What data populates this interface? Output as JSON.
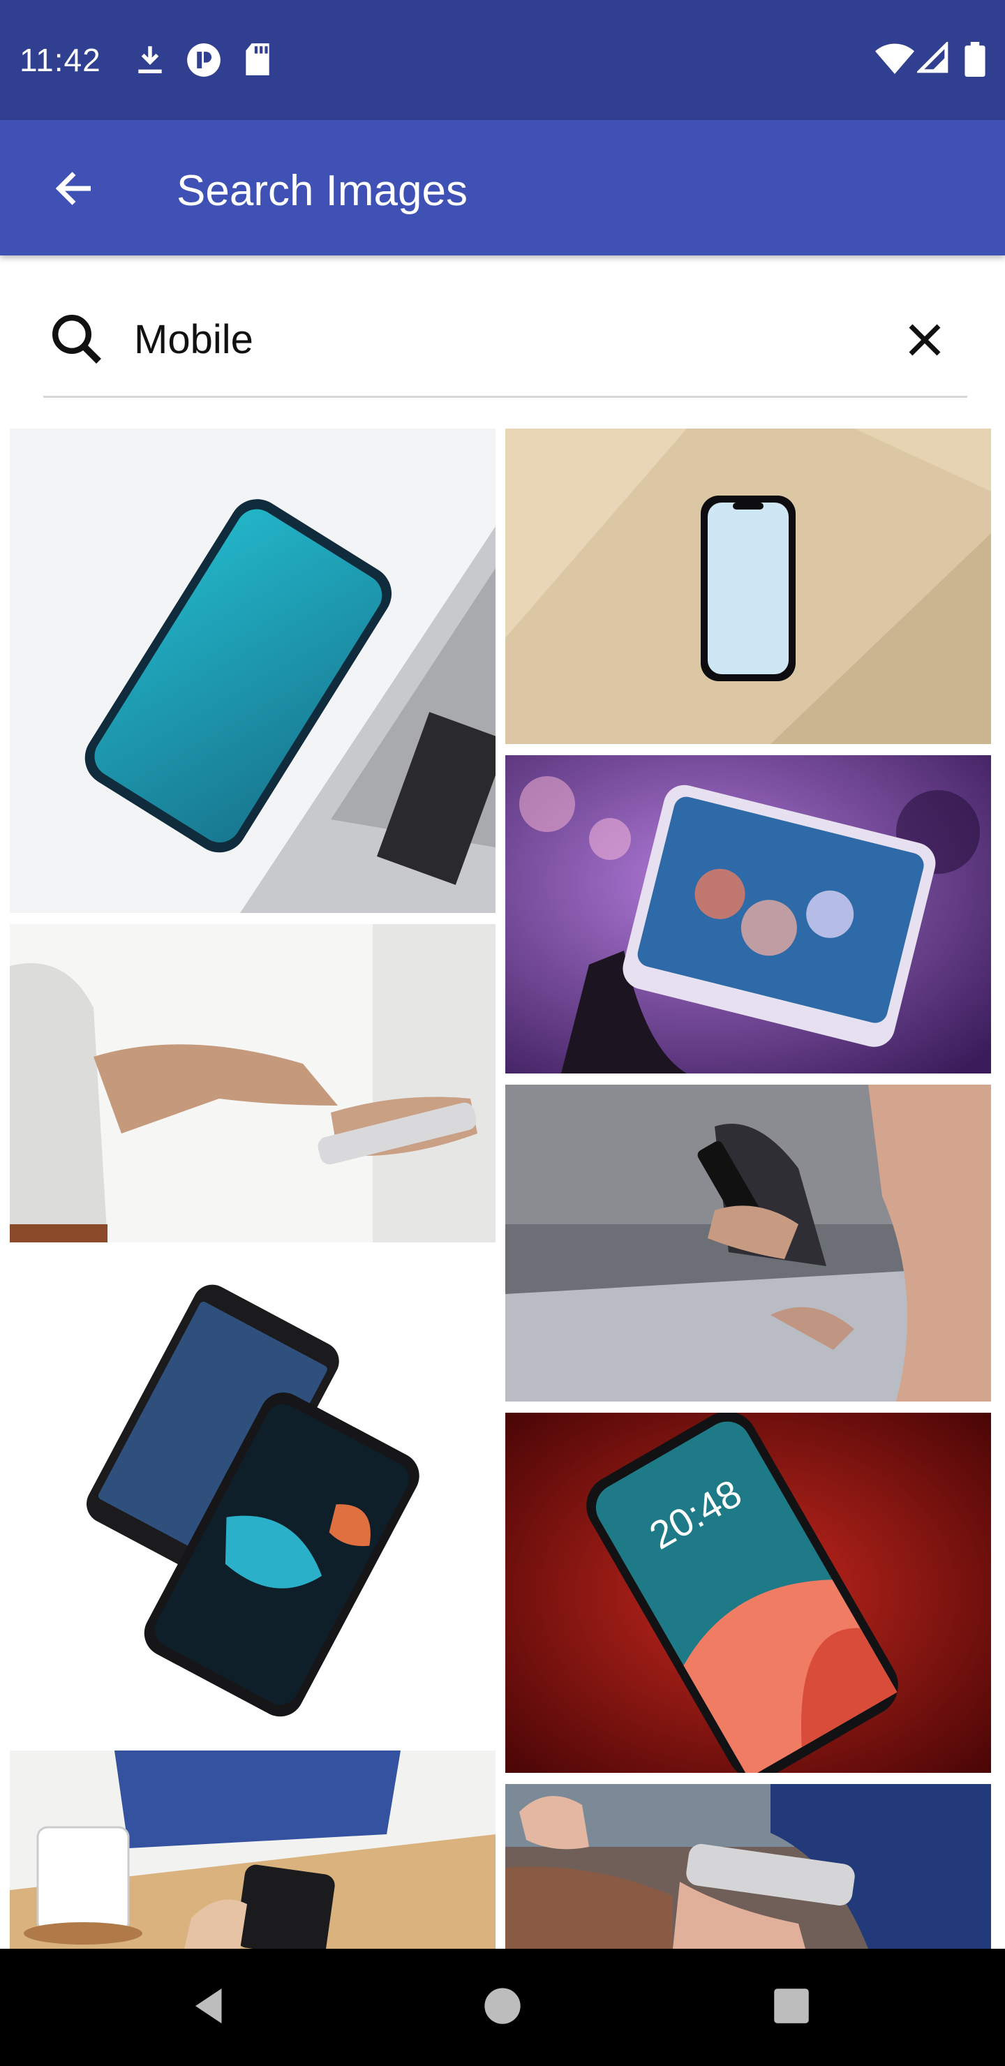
{
  "status_bar": {
    "time": "11:42",
    "left_icons": [
      "download-icon",
      "app-notification-icon",
      "sd-card-icon"
    ],
    "right_icons": [
      "wifi-icon",
      "cell-signal-icon",
      "battery-icon"
    ]
  },
  "app_bar": {
    "title": "Search Images",
    "back_icon": "arrow-back-icon"
  },
  "search": {
    "query": "Mobile",
    "search_icon": "search-icon",
    "clear_icon": "close-icon"
  },
  "results": [
    {
      "name": "result-image-1",
      "alt": "smartphone on laptop"
    },
    {
      "name": "result-image-2",
      "alt": "phone on wooden table"
    },
    {
      "name": "result-image-3",
      "alt": "hand holding phone with bokeh"
    },
    {
      "name": "result-image-4",
      "alt": "man using phone"
    },
    {
      "name": "result-image-5",
      "alt": "people using phones"
    },
    {
      "name": "result-image-6",
      "alt": "two smartphones"
    },
    {
      "name": "result-image-7",
      "alt": "phone on red background"
    },
    {
      "name": "result-image-8",
      "alt": "phone on desk with mug"
    },
    {
      "name": "result-image-9",
      "alt": "hands holding phone"
    }
  ],
  "lock_screen_time": "20:48",
  "nav_bar": {
    "icons": [
      "nav-back-icon",
      "nav-home-icon",
      "nav-recents-icon"
    ]
  }
}
